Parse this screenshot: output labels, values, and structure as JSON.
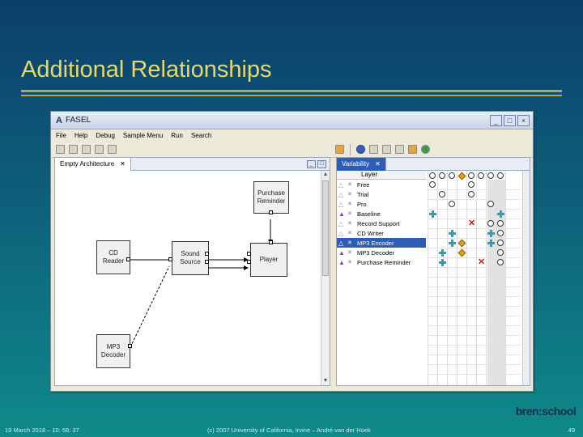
{
  "slide": {
    "title": "Additional Relationships",
    "footer_left": "19 March 2018 – 10: 58: 37",
    "footer_center": "(c) 2007 University of California, Irvine – André van der Hoek",
    "page_number": "49",
    "logo": "bren:school"
  },
  "window": {
    "title": "FASEL",
    "app_icon": "A",
    "menu": [
      "File",
      "Help",
      "Debug",
      "Sample Menu",
      "Run",
      "Search"
    ]
  },
  "left_panel": {
    "tab_label": "Empty Architecture",
    "nodes": {
      "purchase_reminder": "Purchase\nReminder",
      "cd_reader": "CD\nReader",
      "sound_source": "Sound\nSource",
      "player": "Player",
      "mp3_decoder": "MP3\nDecoder"
    }
  },
  "right_panel": {
    "tab_label": "Variability",
    "column_header": "Layer",
    "rows": [
      {
        "label": "Free",
        "selected": false,
        "purple": false
      },
      {
        "label": "Trial",
        "selected": false,
        "purple": false
      },
      {
        "label": "Pro",
        "selected": false,
        "purple": false
      },
      {
        "label": "Baseline",
        "selected": false,
        "purple": true
      },
      {
        "label": "Record Support",
        "selected": false,
        "purple": false
      },
      {
        "label": "CD Writer",
        "selected": false,
        "purple": false
      },
      {
        "label": "MP3 Encoder",
        "selected": true,
        "purple": false
      },
      {
        "label": "MP3 Decoder",
        "selected": false,
        "purple": true
      },
      {
        "label": "Purchase Reminder",
        "selected": false,
        "purple": true
      }
    ]
  },
  "colors": {
    "title": "#e8d868",
    "selection": "#2d5db6",
    "diamond": "#e1a20f",
    "plus": "#2aa0b8",
    "x": "#c42020"
  }
}
